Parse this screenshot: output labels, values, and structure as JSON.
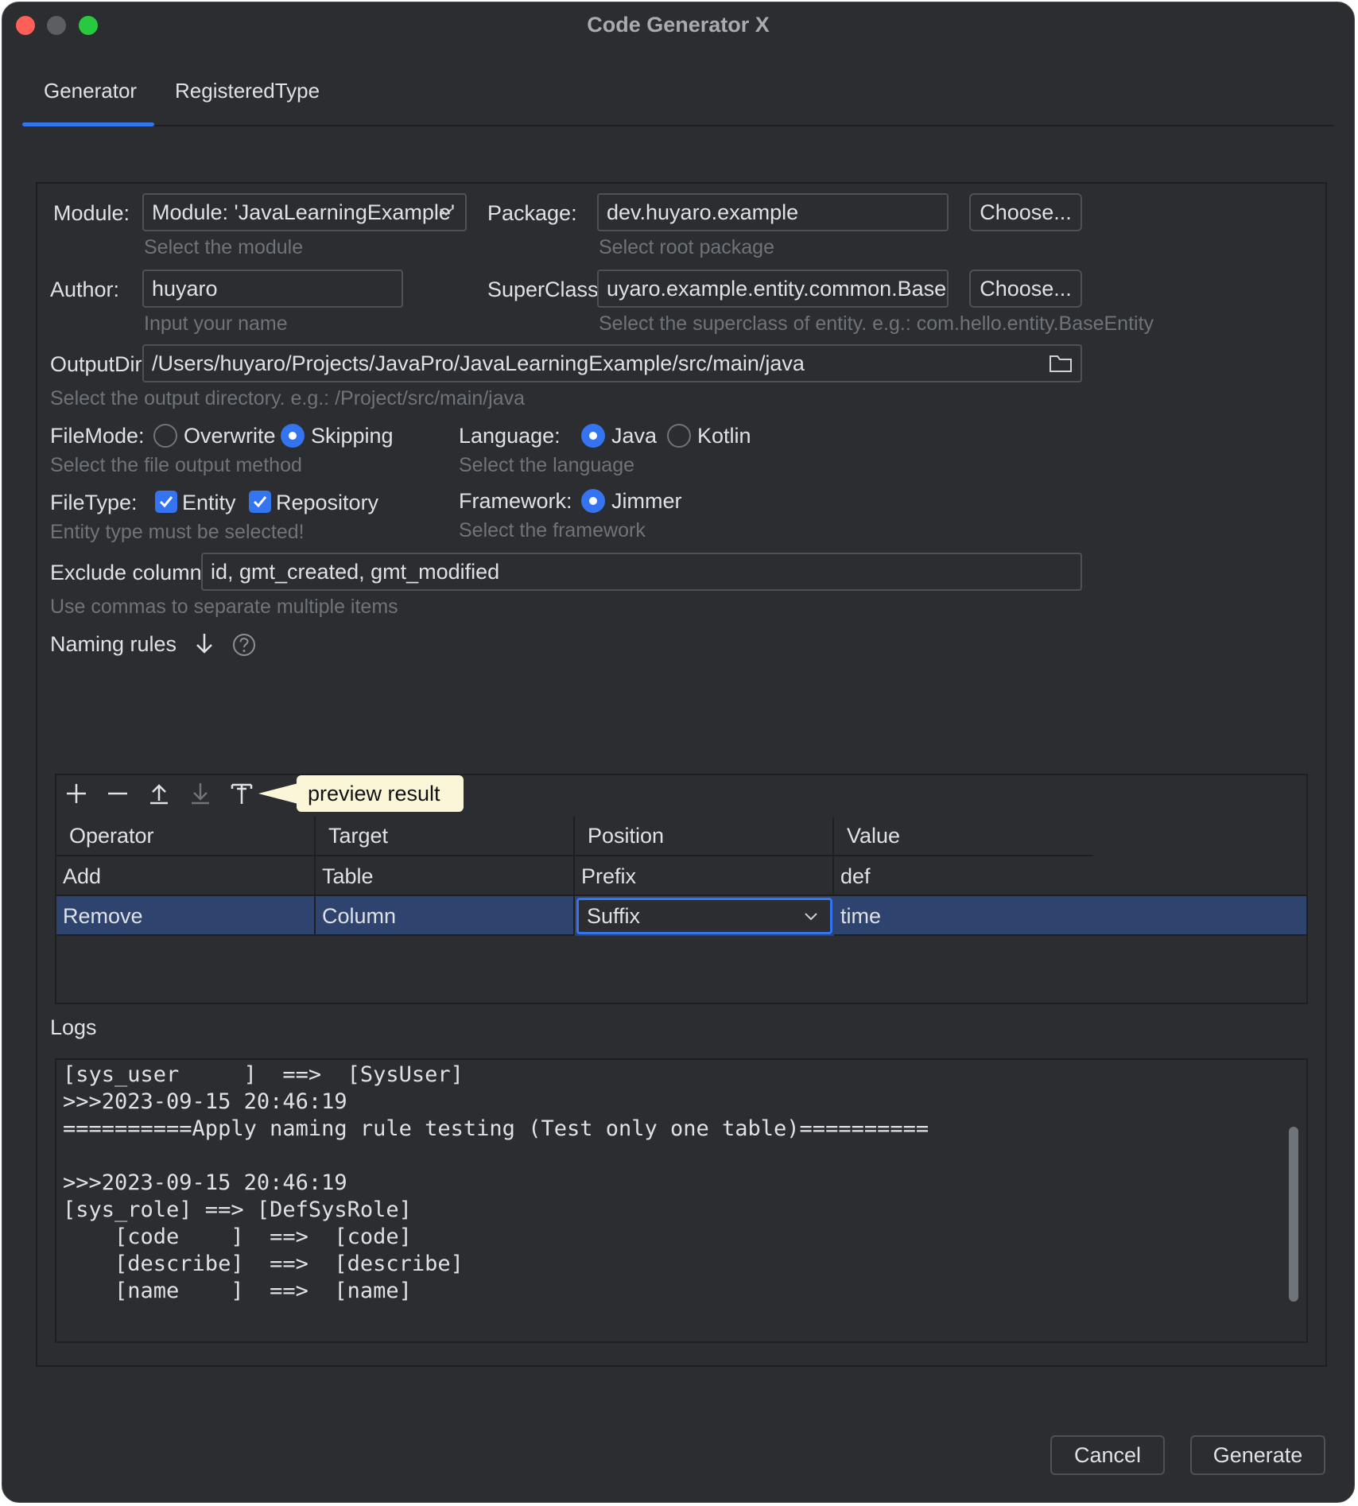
{
  "window": {
    "title": "Code Generator X"
  },
  "tabs": [
    {
      "label": "Generator",
      "active": true
    },
    {
      "label": "RegisteredType",
      "active": false
    }
  ],
  "form": {
    "module": {
      "label": "Module:",
      "value": "Module: 'JavaLearningExample'",
      "hint": "Select the module"
    },
    "package": {
      "label": "Package:",
      "value": "dev.huyaro.example",
      "hint": "Select root package",
      "button": "Choose..."
    },
    "author": {
      "label": "Author:",
      "value": "huyaro",
      "hint": "Input your name"
    },
    "superclass": {
      "label": "SuperClass:",
      "value": "uyaro.example.entity.common.BaseEntity",
      "hint": "Select the superclass of entity. e.g.: com.hello.entity.BaseEntity",
      "button": "Choose..."
    },
    "output_dir": {
      "label": "OutputDir:",
      "value": "/Users/huyaro/Projects/JavaPro/JavaLearningExample/src/main/java",
      "hint": "Select the output directory. e.g.: /Project/src/main/java"
    },
    "file_mode": {
      "label": "FileMode:",
      "options": [
        {
          "label": "Overwrite",
          "selected": false
        },
        {
          "label": "Skipping",
          "selected": true
        }
      ],
      "hint": "Select the file output method"
    },
    "language": {
      "label": "Language:",
      "options": [
        {
          "label": "Java",
          "selected": true
        },
        {
          "label": "Kotlin",
          "selected": false
        }
      ],
      "hint": "Select the language"
    },
    "file_type": {
      "label": "FileType:",
      "options": [
        {
          "label": "Entity",
          "checked": true
        },
        {
          "label": "Repository",
          "checked": true
        }
      ],
      "hint": "Entity type must be selected!"
    },
    "framework": {
      "label": "Framework:",
      "options": [
        {
          "label": "Jimmer",
          "selected": true
        }
      ],
      "hint": "Select the framework"
    },
    "exclude_columns": {
      "label": "Exclude columns:",
      "value": "id, gmt_created, gmt_modified",
      "hint": "Use commas to separate multiple items"
    }
  },
  "naming_rules": {
    "label": "Naming rules",
    "toolbar": [
      "add-icon",
      "remove-icon",
      "move-up-icon",
      "move-down-icon",
      "preview-icon"
    ],
    "tooltip": "preview result",
    "columns": [
      "Operator",
      "Target",
      "Position",
      "Value"
    ],
    "rows": [
      [
        "Add",
        "Table",
        "Prefix",
        "def"
      ],
      [
        "Remove",
        "Column",
        "Suffix",
        "time"
      ]
    ],
    "selected_row": 1
  },
  "logs": {
    "label": "Logs",
    "lines": [
      "[sys_user     ]  ==>  [SysUser]",
      ">>>2023-09-15 20:46:19",
      "==========Apply naming rule testing (Test only one table)==========",
      "",
      ">>>2023-09-15 20:46:19",
      "[sys_role] ==> [DefSysRole]",
      "    [code    ]  ==>  [code]",
      "    [describe]  ==>  [describe]",
      "    [name    ]  ==>  [name]"
    ]
  },
  "footer": {
    "cancel": "Cancel",
    "generate": "Generate"
  },
  "colors": {
    "accent": "#3574f0",
    "background": "#2b2d30",
    "selection": "#2e436e",
    "tooltip": "#fcf6d9"
  }
}
